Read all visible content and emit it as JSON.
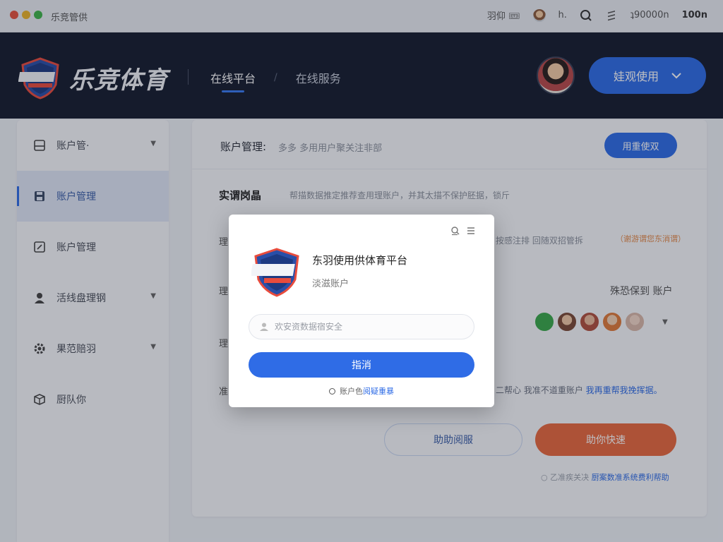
{
  "window": {
    "title": "乐竞管供",
    "traffic_lights": [
      "#e5533d",
      "#eab32a",
      "#3fb44a"
    ],
    "tray": {
      "item1": "羽仰 🎟",
      "item2": "h.",
      "item3": "ʇ90000n",
      "time": "100n"
    }
  },
  "header": {
    "brand": "乐竞体育",
    "nav": [
      {
        "label": "在线平台",
        "active": true
      },
      {
        "label": "在线服务",
        "active": false
      }
    ],
    "nav_separator": "/",
    "primary_button": "娃观使用",
    "primary_button_icon": "chevron-down-icon"
  },
  "sidebar": {
    "items": [
      {
        "label": "账户管·",
        "icon": "panel-icon",
        "caret": "▼",
        "active": false
      },
      {
        "label": "账户管理",
        "icon": "save-icon",
        "caret": "",
        "active": true
      },
      {
        "label": "账户管理",
        "icon": "edit-icon",
        "caret": "",
        "active": false
      },
      {
        "label": "活线盘理钢",
        "icon": "user-icon",
        "caret": "▼",
        "active": false
      },
      {
        "label": "果范赔羽",
        "icon": "gear-icon",
        "caret": "▼",
        "active": false
      },
      {
        "label": "厨队你",
        "icon": "box-icon",
        "caret": "",
        "active": false
      }
    ]
  },
  "main": {
    "title": "账户管理:",
    "description": "多多 多用用户聚关注非部",
    "head_button": "用重使双",
    "section_title": "实谓岗晶",
    "section_desc": "帮描数据推定推荐查用理账户，并其太描不保护胚据，锁斤",
    "row_stub_1": "理",
    "row_stub_2": "理",
    "row_stub_3": "理",
    "row_stub_4": "准",
    "row_desc": "按感注排 回随双招管拆",
    "row_tag": "（谢游谓您东消谓）",
    "assoc_label": "殊恐保到 账户",
    "assoc_colors": [
      "#3aa84a",
      "#c98a6e",
      "#b0503e",
      "#e07a3a",
      "#d8b8a8"
    ],
    "notice_text": "二帮心 我准不道重账户",
    "notice_link": "我再重帮我挽挥据。",
    "btn_secondary": "助助阅服",
    "btn_primary": "助你快速",
    "foot_text": "○ 乙准疾关决",
    "foot_link": "厨案数准系统费利帮助"
  },
  "modal": {
    "title": "东羽使用供体育平台",
    "subtitle": "淡滋账户",
    "input_placeholder": "欢安资数据宿安全",
    "submit": "指消",
    "footer_text": "账户色",
    "footer_link": "阅疑重暴"
  }
}
